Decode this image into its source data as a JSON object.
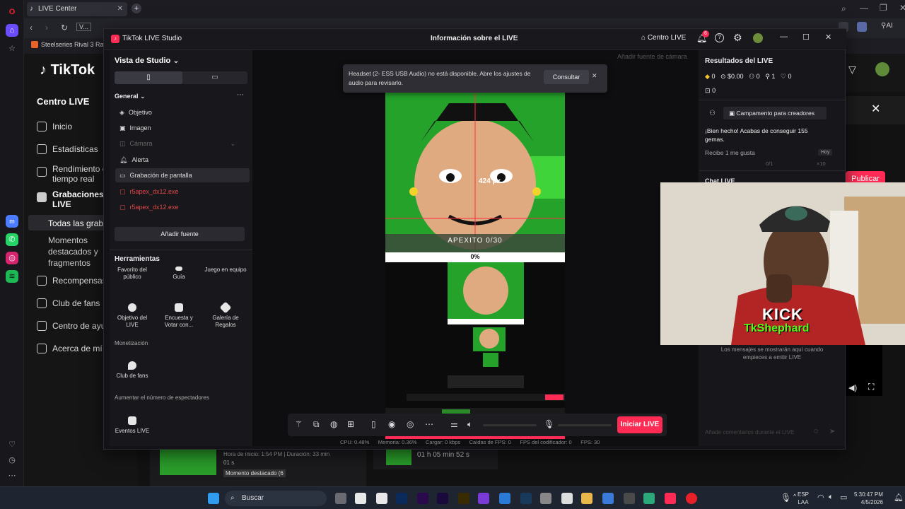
{
  "browser": {
    "tab_title": "LIVE Center",
    "bookmark": "Steelseries Rival 3 Ra...",
    "address_chip": "V..."
  },
  "bg_page": {
    "logo": "TikTok",
    "heading": "Centro LIVE",
    "nav": [
      "Inicio",
      "Estadísticas",
      "Rendimiento e",
      "tiempo real",
      "Grabaciones",
      "LIVE",
      "Todas las graba",
      "Momentos",
      "destacados y",
      "fragmentos",
      "Recompensas",
      "Club de fans",
      "Centro de ayu",
      "Acerca de mí"
    ],
    "publish_button": "Publicar",
    "recording": {
      "start": "Hora de inicio: 1:54 PM | Duración: 33 min",
      "start2": "01 s",
      "highlight": "Momento destacado (6",
      "duration2": "01 h 05 min 52 s"
    }
  },
  "studio": {
    "app_title": "TikTok LIVE Studio",
    "center_title": "Información sobre el LIVE",
    "centro_live": "Centro LIVE",
    "notif_count": "6",
    "studio_view": "Vista de Studio",
    "scene_section": "General",
    "sources": [
      "Objetivo",
      "Imagen",
      "Cámara",
      "Alerta",
      "Grabación de pantalla",
      "r5apex_dx12.exe",
      "r5apex_dx12.exe"
    ],
    "add_source": "Añadir fuente",
    "tools_title": "Herramientas",
    "tools": [
      "Favorito del público",
      "Guía",
      "Juego en equipo",
      "Objetivo del LIVE",
      "Encuesta y Votar con...",
      "Galería de Regalos"
    ],
    "monetization": "Monetización",
    "fan_club": "Club de fans",
    "increase_viewers": "Aumentar el número de espectadores",
    "live_events": "Eventos LIVE",
    "toast_text1": "Headset (2- ESS USB Audio) no está disponible. Abre los ajustes de",
    "toast_text2": "audio para revisarlo.",
    "toast_button": "Consultar",
    "add_camera_hint": "Añadir fuente de cámara",
    "px_label": "424 px",
    "goal_label": "APEXITO 0/30",
    "goal_percent": "0%",
    "start_live": "Iniciar LIVE",
    "stats": {
      "cpu": "CPU: 0.48%",
      "memory": "Memoria: 0.36%",
      "upload": "Cargar: 0 kbps",
      "fps_drop": "Caídas de FPS: 0",
      "enc_fps": "FPS del codificador: 0",
      "fps": "FPS: 30"
    },
    "results_title": "Resultados del LIVE",
    "results": {
      "diamonds": "0",
      "money": "$0.00",
      "viewers": "0",
      "followers": "1",
      "likes": "0",
      "gifts": "0"
    },
    "bootcamp": "Campamento para creadores",
    "congrats1": "¡Bien hecho! Acabas de conseguir 155",
    "congrats2": "gemas.",
    "reward": "Recibe 1 me gusta",
    "reward_badge": "Hoy",
    "reward_progress": "0/1",
    "reward_bonus": "×10",
    "chat_title": "Chat LIVE",
    "chat_empty1": "Los mensajes se mostrarán aquí cuando",
    "chat_empty2": "empieces a emitir LIVE",
    "chat_placeholder": "Añade comentarios durante el LIVE"
  },
  "webcam": {
    "kick": "KICK",
    "handle": "TkShephard"
  },
  "taskbar": {
    "search": "Buscar",
    "lang1": "ESP",
    "lang2": "LAA",
    "time": "5:30:47 PM",
    "date": "4/5/2026"
  },
  "colors": {
    "accent": "#fe2c55",
    "kick_green": "#53fc18",
    "stream_green": "#1fa31f"
  }
}
